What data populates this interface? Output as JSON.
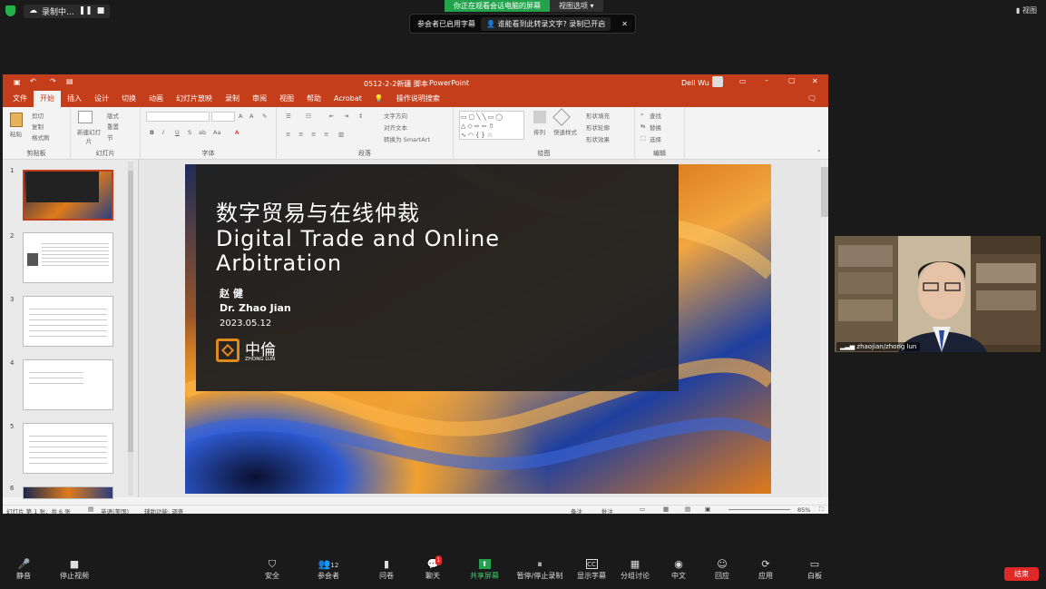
{
  "zoom": {
    "recording_label": "录制中...",
    "share_banner": "你正在观看会话电脑的屏幕",
    "view_options": "视图选项",
    "caption_notice": "参会者已启用字幕",
    "caption_question": "谁能看到此转录文字? 录制已开启",
    "view_button": "视图",
    "participant_name": "zhaojian/zhong lun",
    "participants_count": "12",
    "chat_badge": "1",
    "end_label": "结束",
    "toolbar": [
      {
        "label": "静音",
        "icon": "🎤"
      },
      {
        "label": "停止视频",
        "icon": "■"
      },
      {
        "label": "安全",
        "icon": "⛉"
      },
      {
        "label": "参会者",
        "icon": "👥"
      },
      {
        "label": "问卷",
        "icon": "▮"
      },
      {
        "label": "聊天",
        "icon": "💬"
      },
      {
        "label": "共享屏幕",
        "icon": "⬆"
      },
      {
        "label": "暂停/停止录制",
        "icon": "⏸"
      },
      {
        "label": "显示字幕",
        "icon": "CC"
      },
      {
        "label": "分组讨论",
        "icon": "▦"
      },
      {
        "label": "中文",
        "icon": "◉"
      },
      {
        "label": "回应",
        "icon": "☺"
      },
      {
        "label": "应用",
        "icon": "⟳"
      },
      {
        "label": "白板",
        "icon": "▭"
      }
    ]
  },
  "ppt": {
    "filename": "0512-2-2新疆 脚本",
    "app": "PowerPoint",
    "user": "Dell Wu",
    "tabs": [
      "文件",
      "开始",
      "插入",
      "设计",
      "切换",
      "动画",
      "幻灯片放映",
      "录制",
      "审阅",
      "视图",
      "帮助",
      "Acrobat",
      "操作说明搜索"
    ],
    "groups": [
      "剪贴板",
      "幻灯片",
      "字体",
      "段落",
      "绘图",
      "编辑"
    ],
    "clipboard": {
      "paste": "粘贴",
      "cut": "剪切",
      "copy": "复制",
      "format": "格式刷"
    },
    "slides_group": {
      "new": "新建幻灯片",
      "layout": "版式",
      "reset": "重置",
      "section": "节"
    },
    "paragraph_extras": [
      "文字方向",
      "对齐文本",
      "转换为 SmartArt"
    ],
    "drawing_extras": [
      "形状填充",
      "形状轮廓",
      "形状效果",
      "排列",
      "快速样式"
    ],
    "editing": [
      "查找",
      "替换",
      "选择"
    ],
    "status": {
      "slide_info": "幻灯片 第 1 张，共 6 张",
      "lang": "英语(美国)",
      "accessibility": "辅助功能: 调查",
      "notes": "备注",
      "comments": "批注",
      "zoom": "85%"
    },
    "thumb_numbers": [
      "1",
      "2",
      "3",
      "4",
      "5",
      "6"
    ],
    "slide": {
      "title_cn": "数字贸易与在线仲裁",
      "title_en_1": "Digital Trade and Online",
      "title_en_2": "Arbitration",
      "name_cn": "赵 健",
      "name_en": "Dr. Zhao Jian",
      "date": "2023.05.12",
      "logo_cn": "中倫",
      "logo_en": "ZHONG LUN"
    }
  },
  "colors": {
    "accent": "#c43e1c",
    "logo": "#e08a1e",
    "green": "#23a24d",
    "end": "#e02828"
  }
}
